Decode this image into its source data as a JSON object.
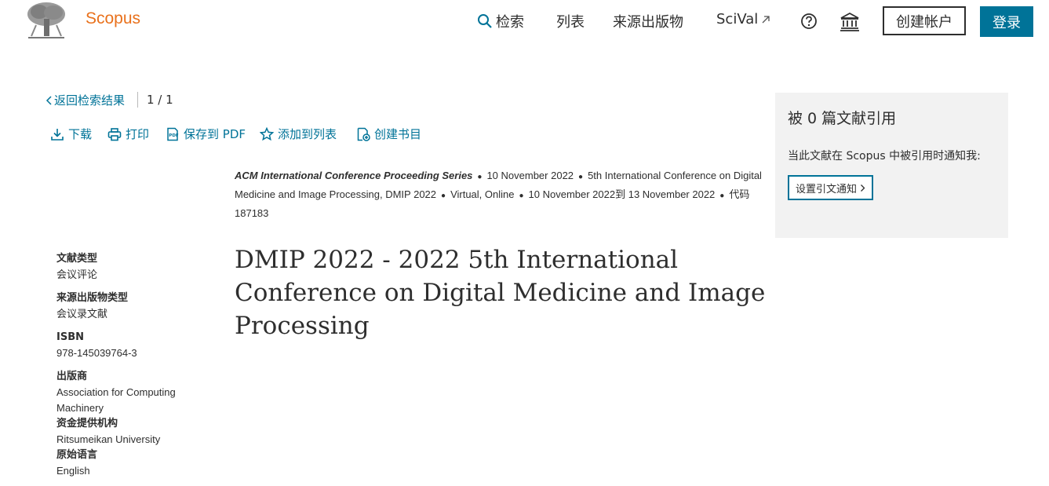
{
  "header": {
    "brand": "Scopus",
    "nav": {
      "search": "检索",
      "list": "列表",
      "sources": "来源出版物",
      "scival": "SciVal"
    },
    "create_account": "创建帐户",
    "login": "登录"
  },
  "back": {
    "label": "返回检索结果",
    "pager": "1 / 1"
  },
  "toolbar": {
    "download": "下载",
    "print": "打印",
    "save_pdf": "保存到 PDF",
    "add_list": "添加到列表",
    "bibliography": "创建书目"
  },
  "meta": {
    "series": "ACM International Conference Proceeding Series",
    "date": "10 November 2022",
    "conference": "5th International Conference on Digital Medicine and Image Processing, DMIP 2022",
    "location": "Virtual, Online",
    "dates": "10 November 2022到 13 November 2022",
    "code": "代码 187183"
  },
  "title": "DMIP 2022 - 2022 5th International Conference on Digital Medicine and Image Processing",
  "details": [
    {
      "label": "文献类型",
      "value": "会议评论"
    },
    {
      "label": "来源出版物类型",
      "value": "会议录文献"
    },
    {
      "label": "ISBN",
      "value": "978-145039764-3"
    },
    {
      "label": "出版商",
      "value": "Association for Computing Machinery"
    },
    {
      "label": "资金提供机构",
      "value": "Ritsumeikan University"
    },
    {
      "label": "原始语言",
      "value": "English"
    }
  ],
  "citations": {
    "heading": "被 0 篇文献引用",
    "text": "当此文献在 Scopus 中被引用时通知我:",
    "button": "设置引文通知"
  },
  "colors": {
    "brand": "#e9711c",
    "link": "#007398",
    "panel": "#f2f2f2"
  }
}
